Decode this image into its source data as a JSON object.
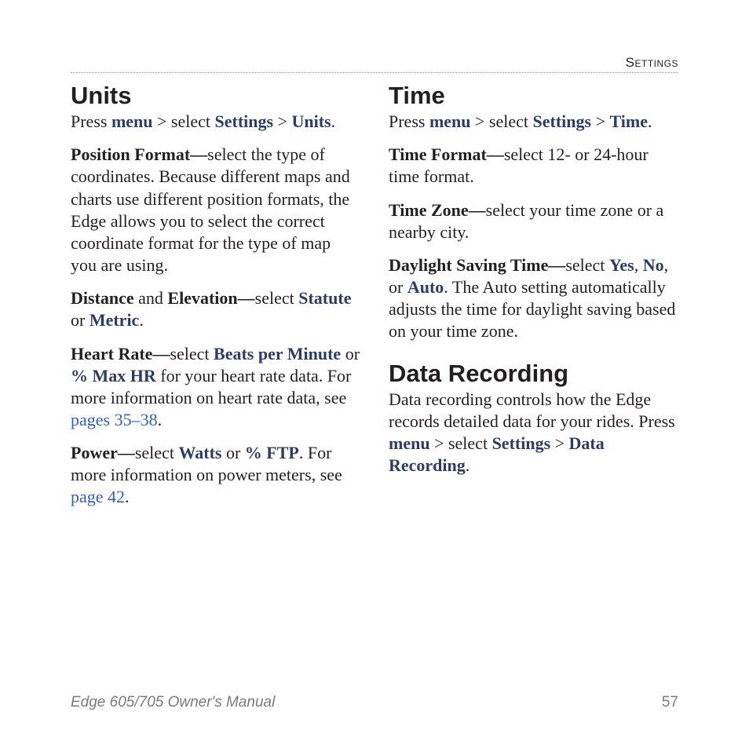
{
  "header": {
    "running_head": "Settings"
  },
  "col1": {
    "units": {
      "heading": "Units",
      "intro": {
        "t1": "Press ",
        "menu": "menu",
        "t2": " > select ",
        "settings": "Settings",
        "t3": " > ",
        "units": "Units",
        "t4": "."
      },
      "position": {
        "label": "Position Format",
        "dash": "—",
        "text": "select the type of coordinates. Because different maps and charts use different position formats, the Edge allows you to select the correct coordinate format for the type of map you are using."
      },
      "distance": {
        "label1": "Distance",
        "and": " and ",
        "label2": "Elevation",
        "dash": "—",
        "text1": "select ",
        "opt1": "Statute",
        "or": " or ",
        "opt2": "Metric",
        "dot": "."
      },
      "heart": {
        "label": "Heart Rate",
        "dash": "—",
        "t1": "select ",
        "opt1": "Beats per Minute",
        "or": " or ",
        "opt2": "% Max HR",
        "t2": " for your heart rate data. For more information on heart rate data, see ",
        "link": "pages 35–38",
        "dot": "."
      },
      "power": {
        "label": "Power",
        "dash": "—",
        "t1": "select ",
        "opt1": "Watts",
        "or": " or ",
        "opt2": "% FTP",
        "t2": ". For more information on power meters, see ",
        "link": "page 42",
        "dot": "."
      }
    }
  },
  "col2": {
    "time": {
      "heading": "Time",
      "intro": {
        "t1": "Press ",
        "menu": "menu",
        "t2": " > select ",
        "settings": "Settings",
        "t3": " > ",
        "time": "Time",
        "t4": "."
      },
      "format": {
        "label": "Time Format",
        "dash": "—",
        "text": "select 12- or 24-hour time format."
      },
      "zone": {
        "label": "Time Zone",
        "dash": "—",
        "text": "select your time zone or a nearby city."
      },
      "dst": {
        "label": "Daylight Saving Time",
        "dash": "—",
        "t1": "select ",
        "yes": "Yes",
        "c1": ", ",
        "no": "No",
        "c2": ", or ",
        "auto": "Auto",
        "t2": ". The Auto setting automatically adjusts the time for daylight saving based on your time zone."
      }
    },
    "recording": {
      "heading": "Data Recording",
      "p": {
        "t1": "Data recording controls how the Edge records detailed data for your rides. Press ",
        "menu": "menu",
        "t2": " > select ",
        "settings": "Settings",
        "t3": " > ",
        "dr": "Data Recording",
        "t4": "."
      }
    }
  },
  "footer": {
    "title": "Edge 605/705 Owner's Manual",
    "page": "57"
  }
}
